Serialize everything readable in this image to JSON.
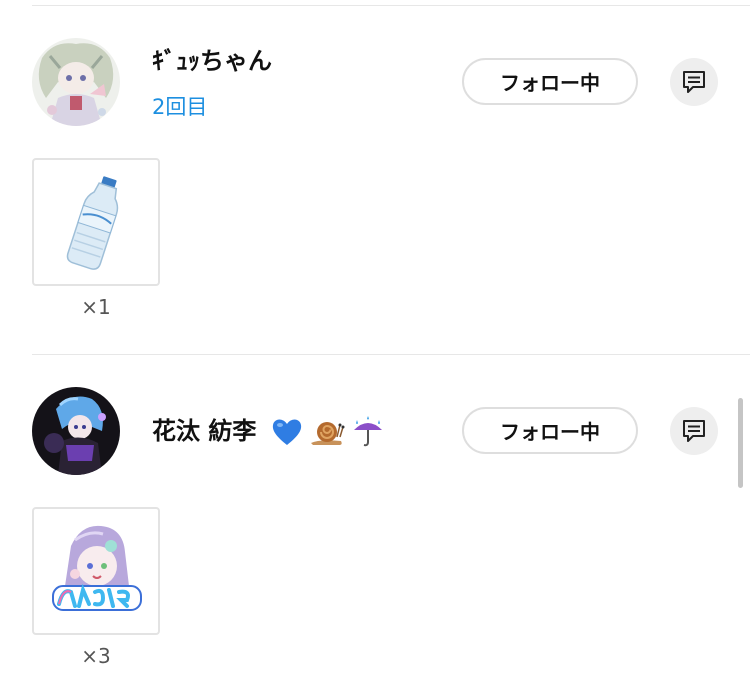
{
  "users": [
    {
      "name": "ｷﾞｭｯちゃん",
      "visit_label": "2回目",
      "follow_label": "フォロー中",
      "gift_count": "×1",
      "gift_icon": "water-bottle-icon",
      "avatar_icon": "character-avatar-icon"
    },
    {
      "name": "花汰 紡李",
      "visit_label": "",
      "follow_label": "フォロー中",
      "gift_count": "×3",
      "gift_icon": "character-sticker-icon",
      "avatar_icon": "character-avatar-icon",
      "name_emojis": [
        "blue-heart-icon",
        "snail-icon",
        "umbrella-rain-icon"
      ]
    }
  ],
  "colors": {
    "accent_blue": "#1d8fe0",
    "button_border": "#dedede",
    "divider": "#e7e7e7"
  }
}
